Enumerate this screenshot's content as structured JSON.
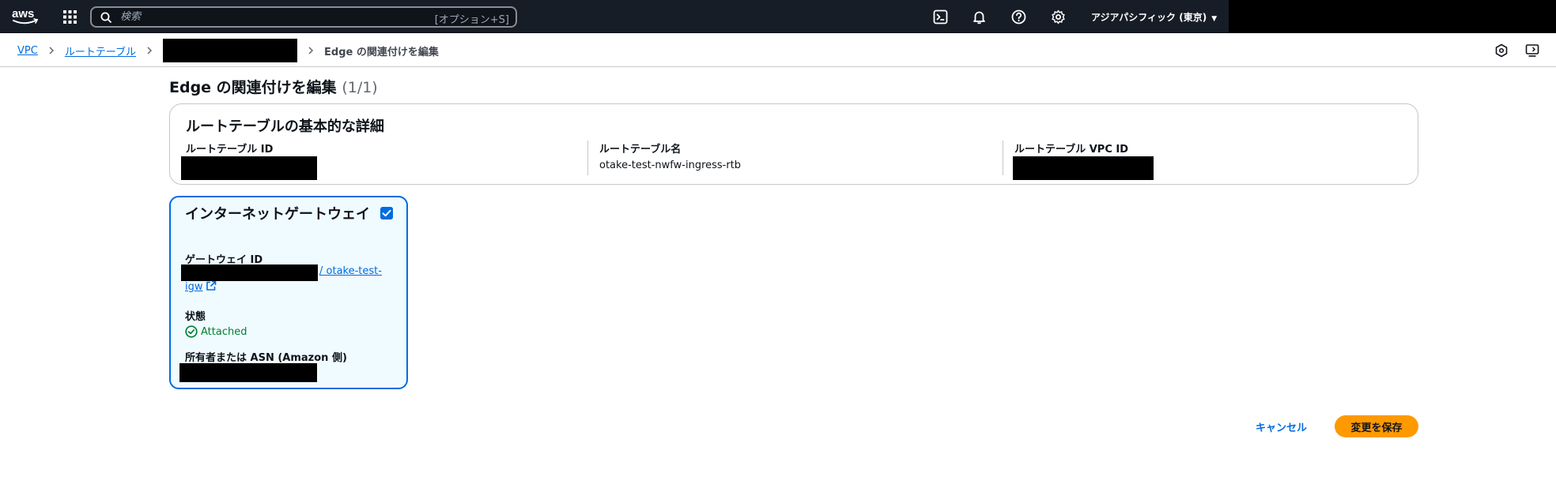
{
  "topnav": {
    "logo_text": "aws",
    "search": {
      "placeholder": "検索",
      "shortcut": "[オプション+S]"
    },
    "icons": [
      "cloudshell-icon",
      "bell-icon",
      "help-icon",
      "gear-icon"
    ],
    "region": "アジアパシフィック (東京)"
  },
  "breadcrumb": {
    "items": [
      "VPC",
      "ルートテーブル"
    ],
    "current": "Edge の関連付けを編集"
  },
  "page": {
    "title": "Edge の関連付けを編集",
    "count": "(1/1)"
  },
  "details": {
    "heading": "ルートテーブルの基本的な詳細",
    "fields": [
      {
        "label": "ルートテーブル ID",
        "value": ""
      },
      {
        "label": "ルートテーブル名",
        "value": "otake-test-nwfw-ingress-rtb"
      },
      {
        "label": "ルートテーブル VPC ID",
        "value": ""
      }
    ]
  },
  "igw_card": {
    "title": "インターネットゲートウェイ",
    "checked": true,
    "gateway_label": "ゲートウェイ ID",
    "gateway_link": "/ otake-test-igw",
    "status_label": "状態",
    "status_value": "Attached",
    "owner_label": "所有者または ASN (Amazon 側)"
  },
  "footer": {
    "cancel_label": "キャンセル",
    "save_label": "変更を保存"
  },
  "colors": {
    "nav_bg": "#161d26",
    "link": "#006ce0",
    "primary": "#ff9900",
    "success": "#00802f",
    "selected_bg": "#f0fbff"
  }
}
